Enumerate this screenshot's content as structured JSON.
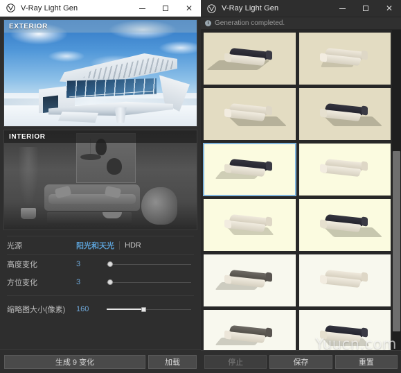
{
  "left_window": {
    "title": "V-Ray Light Gen",
    "logo_icon": "vray-logo-icon",
    "controls": {
      "minimize": "minimize-icon",
      "maximize": "maximize-icon",
      "close": "close-icon"
    },
    "previews": [
      {
        "label": "EXTERIOR",
        "state": "selected"
      },
      {
        "label": "INTERIOR",
        "state": "normal"
      }
    ],
    "settings": {
      "light_source": {
        "label": "光源",
        "options": [
          "阳光和天光",
          "HDR"
        ],
        "selected": "阳光和天光"
      },
      "height_variation": {
        "label": "高度变化",
        "value": "3",
        "slider_percent": 3
      },
      "azimuth_variation": {
        "label": "方位变化",
        "value": "3",
        "slider_percent": 3
      },
      "thumbnail_size": {
        "label": "缩略图大小(像素)",
        "value": "160",
        "slider_percent": 42
      }
    },
    "buttons": {
      "generate": "生成 9 变化",
      "load": "加载"
    }
  },
  "right_window": {
    "title": "V-Ray Light Gen",
    "logo_icon": "vray-logo-icon",
    "controls": {
      "minimize": "minimize-icon",
      "maximize": "maximize-icon",
      "close": "close-icon"
    },
    "status": {
      "icon": "info-icon",
      "text": "Generation completed."
    },
    "selection_color": "#7fb4dd",
    "thumbnails": [
      {
        "index": 1,
        "bg": "#e3dcc2",
        "sofa": "dark",
        "shadow": "long-left",
        "selected": false
      },
      {
        "index": 2,
        "bg": "#e3dcc2",
        "sofa": "light",
        "shadow": "short",
        "selected": false
      },
      {
        "index": 3,
        "bg": "#e3dcc2",
        "sofa": "light",
        "shadow": "long-right",
        "selected": false
      },
      {
        "index": 4,
        "bg": "#e3dcc2",
        "sofa": "dark",
        "shadow": "long-right",
        "selected": false
      },
      {
        "index": 5,
        "bg": "#fbfbe0",
        "sofa": "dark",
        "shadow": "left",
        "selected": true
      },
      {
        "index": 6,
        "bg": "#fbfbe0",
        "sofa": "light",
        "shadow": "none",
        "selected": false
      },
      {
        "index": 7,
        "bg": "#fbfbe0",
        "sofa": "light",
        "shadow": "right",
        "selected": false
      },
      {
        "index": 8,
        "bg": "#fbfbe0",
        "sofa": "dark",
        "shadow": "long-right",
        "selected": false
      },
      {
        "index": 9,
        "bg": "#f8f8ee",
        "sofa": "mid",
        "shadow": "left",
        "selected": false
      },
      {
        "index": 10,
        "bg": "#f8f8ee",
        "sofa": "light",
        "shadow": "none",
        "selected": false
      },
      {
        "index": 11,
        "bg": "#f8f8ee",
        "sofa": "mid",
        "shadow": "left",
        "selected": false
      },
      {
        "index": 12,
        "bg": "#f8f8ee",
        "sofa": "dark",
        "shadow": "right",
        "selected": false
      }
    ],
    "buttons": {
      "stop": "停止",
      "save": "保存",
      "reset": "重置"
    },
    "stop_disabled": true
  },
  "watermark": "Yuucn.com"
}
